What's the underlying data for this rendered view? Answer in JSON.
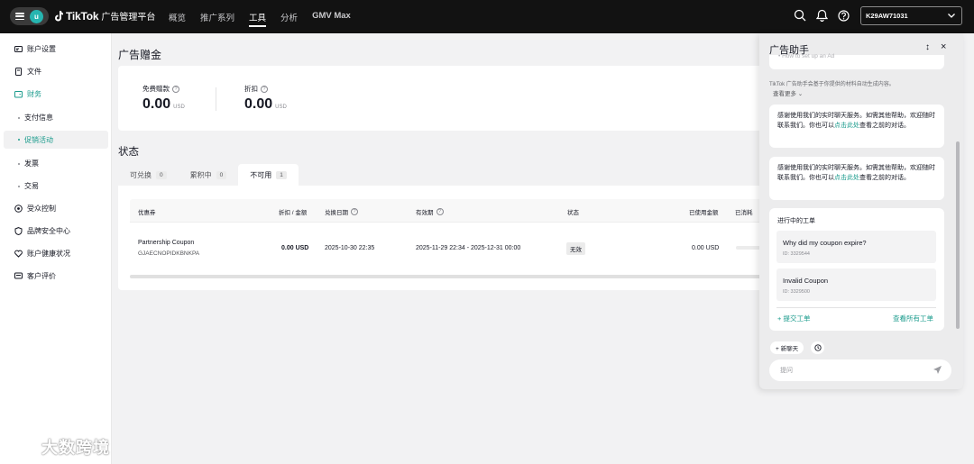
{
  "header": {
    "avatar_letter": "u",
    "logo_text": "TikTok",
    "logo_sub": "广告管理平台",
    "nav": [
      "概览",
      "推广系列",
      "工具",
      "分析",
      "GMV Max"
    ],
    "account_id": "K29AW71031"
  },
  "sidebar": {
    "items": [
      "账户设置",
      "文件",
      "财务",
      "受众控制",
      "品牌安全中心",
      "账户健康状况",
      "客户评价"
    ],
    "finance_sub": [
      "支付信息",
      "促销活动",
      "发票",
      "交易"
    ],
    "watermark": "大数跨境"
  },
  "main": {
    "title": "广告赠金",
    "free_amount_label": "免费赠款",
    "free_amount_value": "0.00",
    "discount_label": "折扣",
    "discount_value": "0.00",
    "currency": "USD",
    "status_title": "状态",
    "tabs": [
      {
        "label": "可兑换",
        "count": "0"
      },
      {
        "label": "累积中",
        "count": "0"
      },
      {
        "label": "不可用",
        "count": "1"
      }
    ],
    "columns": [
      "优惠券",
      "折扣 / 金额",
      "兑换日期",
      "有效期",
      "状态",
      "已使用金额",
      "已消耗"
    ],
    "row": {
      "coupon_name": "Partnership Coupon",
      "coupon_code": "GJAECNOPIDKBNKPA",
      "amount": "0.00 USD",
      "redeem_date": "2025-10-30 22:35",
      "validity": "2025-11-29 22:34 - 2025-12-31 00:00",
      "status": "无效",
      "used": "0.00 USD"
    }
  },
  "assistant": {
    "title": "广告助手",
    "faded_link": "How to set up an Ad",
    "disclaimer": "TikTok 广告助手会基于你提供的材料自动生成内容。",
    "see_more": "查看更多",
    "msg_pre": "感谢使用我们的实时聊天服务。如需其他帮助，欢迎随时联系我们。你也可以",
    "msg_link": "点击此处",
    "msg_post": "查看之前的对话。",
    "tickets_title": "进行中的工单",
    "tickets": [
      {
        "q": "Why did my coupon expire?",
        "id": "ID: 3329544"
      },
      {
        "q": "Invalid Coupon",
        "id": "ID: 3329500"
      }
    ],
    "submit_ticket": "+ 提交工单",
    "view_all": "查看所有工单",
    "new_chat": "+ 新聊天",
    "input_placeholder": "提问"
  }
}
